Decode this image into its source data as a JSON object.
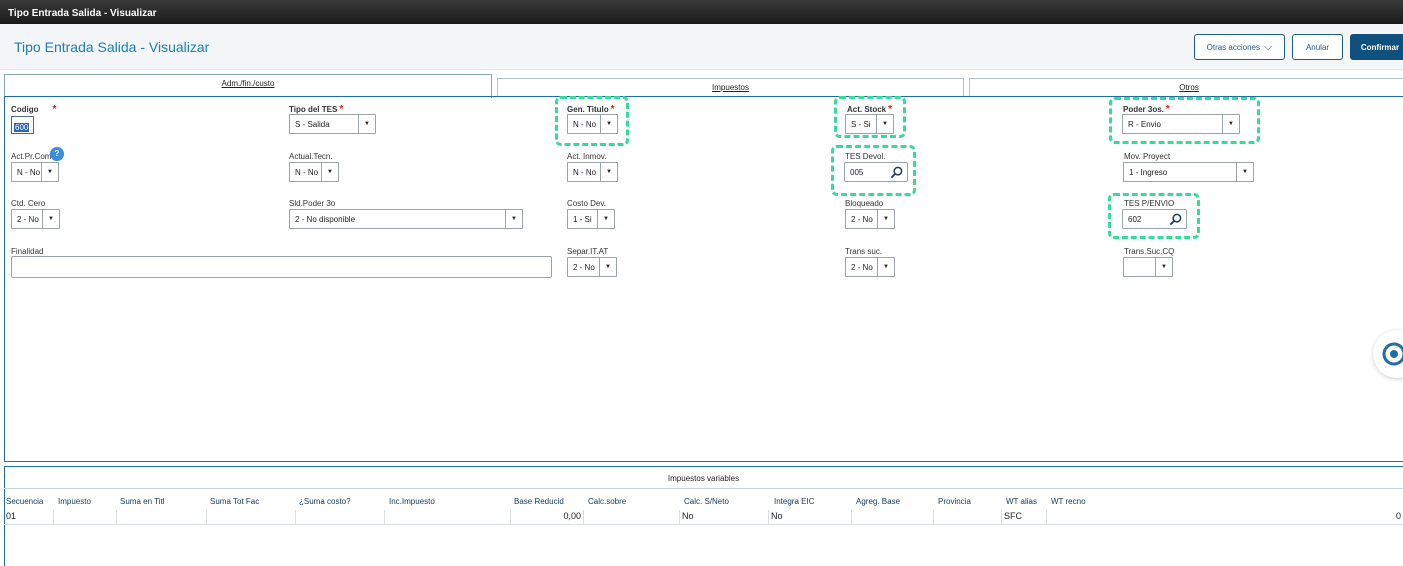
{
  "window": {
    "title": "Tipo Entrada Salida - Visualizar"
  },
  "header": {
    "title": "Tipo Entrada Salida - Visualizar",
    "otras_acciones": "Otras acciones",
    "anular": "Anular",
    "confirmar": "Confirmar"
  },
  "tabs": [
    "Adm./fin./custo",
    "Impuestos",
    "Otros"
  ],
  "fields": {
    "codigo": {
      "label": "Codigo",
      "value": "600"
    },
    "tipo_tes": {
      "label": "Tipo del TES",
      "value": "S - Salida"
    },
    "gen_titulo": {
      "label": "Gen. Titulo",
      "value": "N - No"
    },
    "act_stock": {
      "label": "Act. Stock",
      "value": "S - Si"
    },
    "poder_3os": {
      "label": "Poder 3os.",
      "value": "R - Envio"
    },
    "act_pr_com": {
      "label": "Act.Pr.Com",
      "value": "N - No"
    },
    "actual_tecn": {
      "label": "Actual.Tecn.",
      "value": "N - No"
    },
    "act_inmov": {
      "label": "Act. Inmov.",
      "value": "N - No"
    },
    "tes_devol": {
      "label": "TES Devol.",
      "value": "005"
    },
    "mov_proyect": {
      "label": "Mov. Proyect",
      "value": "1 - Ingreso"
    },
    "ctd_cero": {
      "label": "Ctd. Cero",
      "value": "2 - No"
    },
    "sld_poder": {
      "label": "Sld.Poder 3o",
      "value": "2 - No disponible"
    },
    "costo_dev": {
      "label": "Costo Dev.",
      "value": "1 - Si"
    },
    "bloqueado": {
      "label": "Bloqueado",
      "value": "2 - No"
    },
    "tes_penvio": {
      "label": "TES P/ENVIO",
      "value": "602"
    },
    "finalidad": {
      "label": "Finalidad",
      "value": ""
    },
    "separ_itat": {
      "label": "Separ.IT.AT",
      "value": "2 - No"
    },
    "trans_suc": {
      "label": "Trans suc.",
      "value": "2 - No"
    },
    "trans_suc_cq": {
      "label": "Trans.Suc.CQ",
      "value": ""
    }
  },
  "grid": {
    "title": "Impuestos variables",
    "columns": [
      "Secuencia",
      "Impuesto",
      "Suma en Titl",
      "Suma Tot Fac",
      "¿Suma costo?",
      "Inc.Impuesto",
      "Base Reducid",
      "Calc.sobre",
      "Calc. S/Neto",
      "Integra EIC",
      "Agreg. Base",
      "Provincia",
      "WT alias",
      "WT recno"
    ],
    "row": {
      "secuencia": "01",
      "base_reducid": "0,00",
      "calc_s_neto": "No",
      "integra_eic": "No",
      "wt_alias": "SFC",
      "wt_recno": "0"
    }
  },
  "colors": {
    "accent": "#10507f",
    "title": "#1a7fb5",
    "highlight": "#33dd99"
  }
}
